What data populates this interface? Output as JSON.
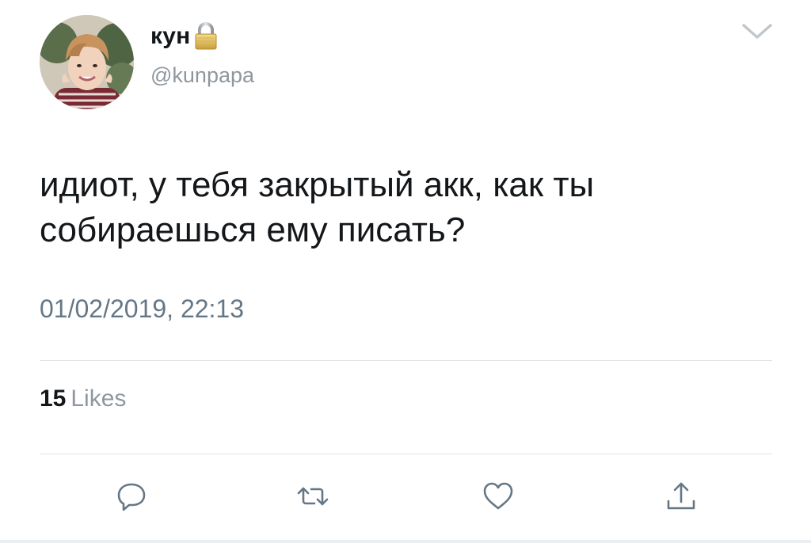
{
  "user": {
    "display_name": "кун",
    "handle": "@kunpapa"
  },
  "tweet": {
    "text_lines": [
      "идиот, у тебя закрытый акк, как ты",
      "собираешься ему писать?"
    ],
    "timestamp": "01/02/2019, 22:13"
  },
  "stats": {
    "likes_count": "15",
    "likes_label": "Likes"
  },
  "icons": {
    "menu": "chevron-down-icon",
    "lock": "lock-icon",
    "reply": "reply-icon",
    "retweet": "retweet-icon",
    "like": "heart-icon",
    "share": "share-icon"
  },
  "colors": {
    "text": "#14171a",
    "muted": "#8f979e",
    "divider": "#dde2e6",
    "icon": "#657786"
  }
}
